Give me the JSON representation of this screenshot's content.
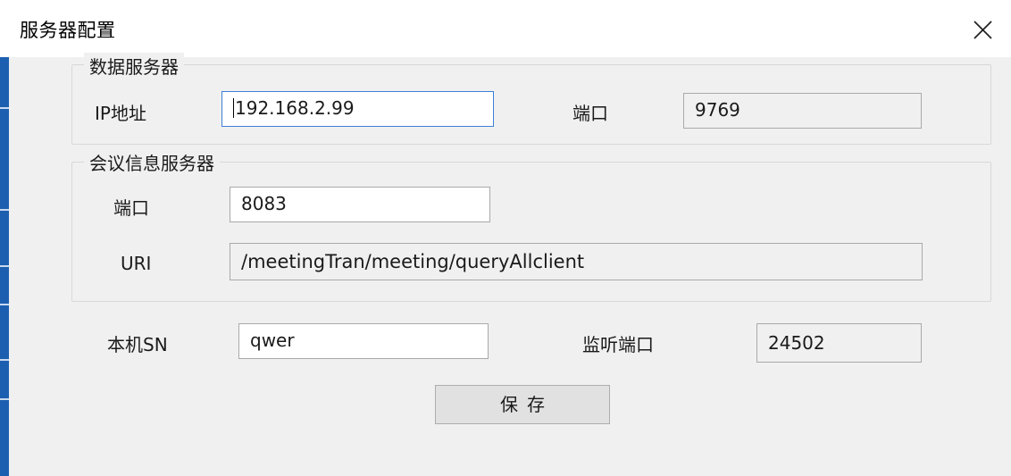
{
  "window": {
    "title": "服务器配置",
    "close_icon": "close-icon"
  },
  "data_server": {
    "legend": "数据服务器",
    "ip_label": "IP地址",
    "ip_value": "192.168.2.99",
    "port_label": "端口",
    "port_value": "9769"
  },
  "meeting_server": {
    "legend": "会议信息服务器",
    "port_label": "端口",
    "port_value": "8083",
    "uri_label": "URI",
    "uri_value": "/meetingTran/meeting/queryAllclient"
  },
  "local": {
    "sn_label": "本机SN",
    "sn_value": "qwer",
    "listen_port_label": "监听端口",
    "listen_port_value": "24502"
  },
  "actions": {
    "save_label": "保存"
  },
  "colors": {
    "dialog_background": "#f0f0f0",
    "focus_border": "#3b7fd6",
    "side_strip": "#1c5fb0"
  }
}
